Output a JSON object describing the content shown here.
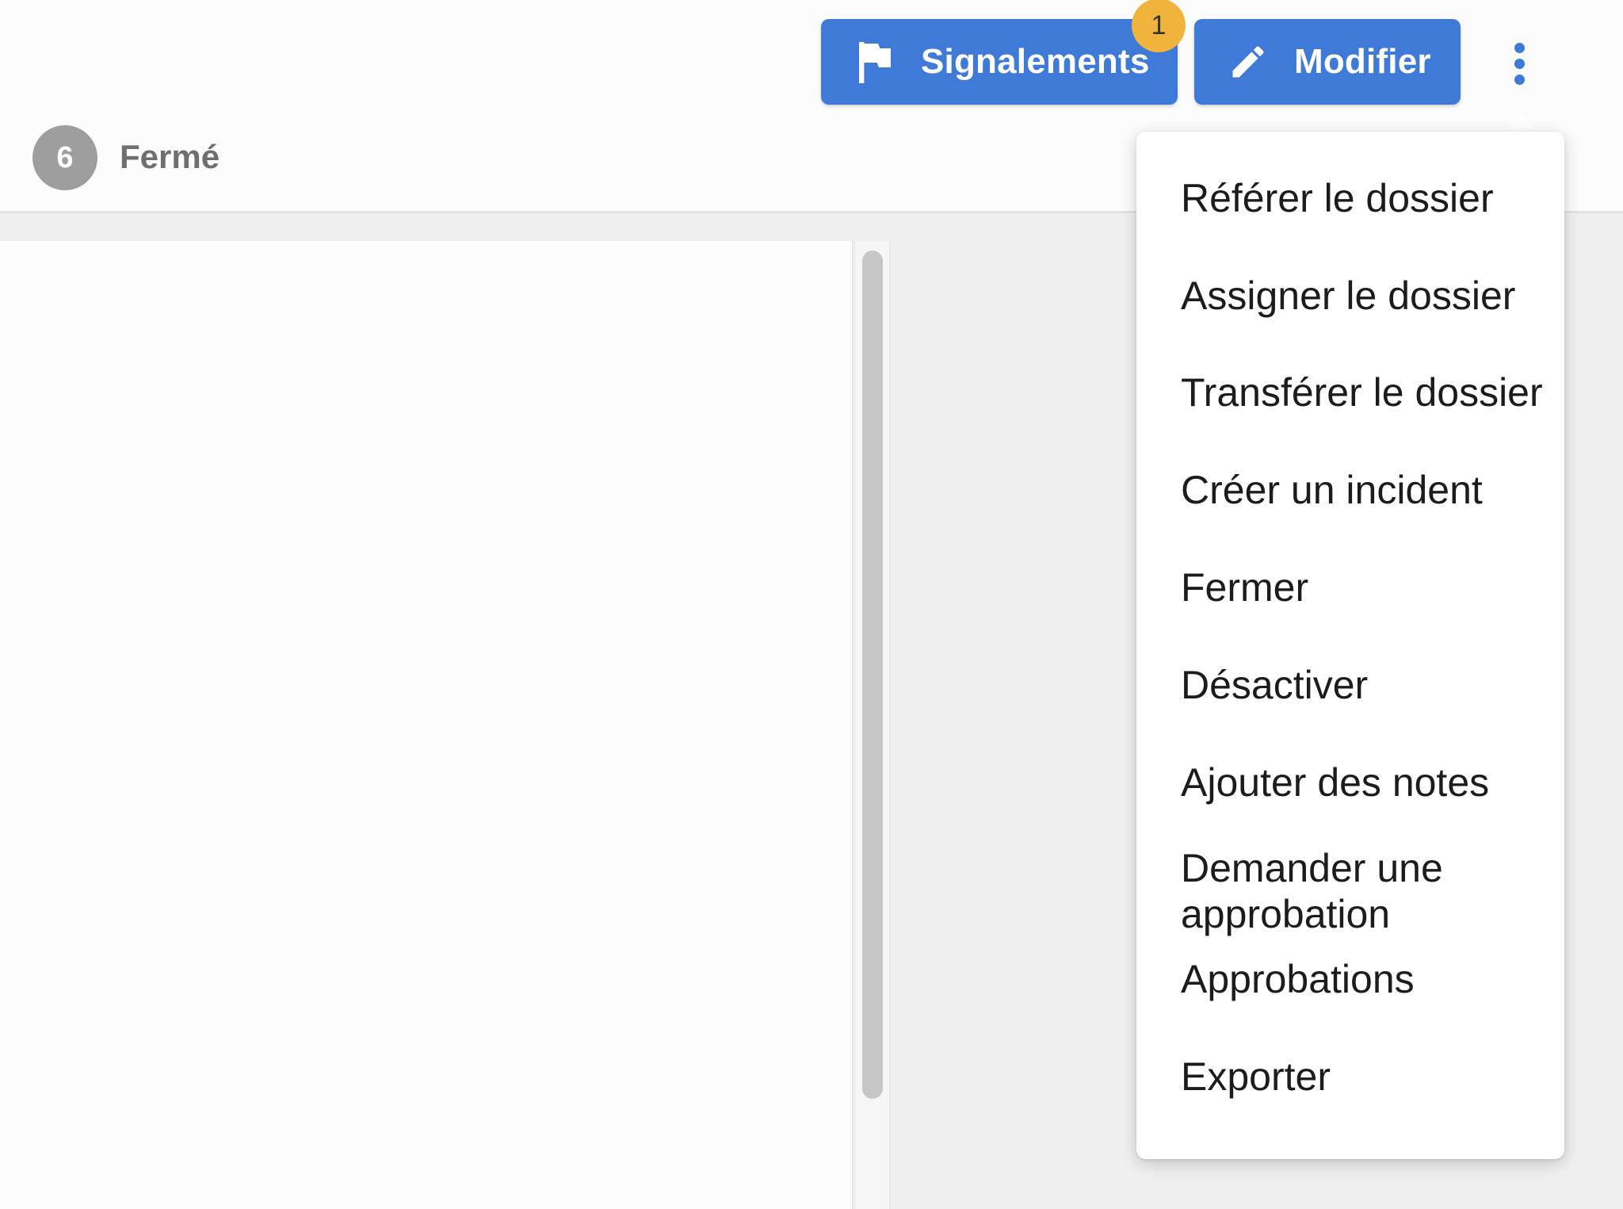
{
  "header": {
    "step_number": "6",
    "status": "Fermé"
  },
  "toolbar": {
    "reports_label": "Signalements",
    "reports_icon": "flag-icon",
    "reports_badge_count": "1",
    "edit_label": "Modifier",
    "edit_icon": "pencil-icon",
    "more_icon": "kebab-menu-icon"
  },
  "menu": {
    "items": [
      {
        "label": "Référer le dossier"
      },
      {
        "label": "Assigner le dossier"
      },
      {
        "label": "Transférer le dossier"
      },
      {
        "label": "Créer un incident"
      },
      {
        "label": "Fermer"
      },
      {
        "label": "Désactiver"
      },
      {
        "label": "Ajouter des notes"
      },
      {
        "label": "Demander une approbation"
      },
      {
        "label": "Approbations"
      },
      {
        "label": "Exporter"
      }
    ]
  },
  "colors": {
    "primary": "#3f7ad8",
    "badge": "#f0b43c",
    "step_circle": "#9e9e9e"
  }
}
